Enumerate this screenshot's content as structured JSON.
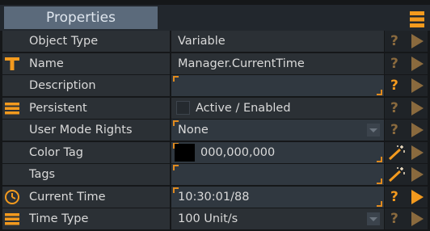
{
  "panel": {
    "title": "Properties",
    "accent_color": "#f39a1e",
    "menu_icon": "hamburger-menu-icon"
  },
  "rows": [
    {
      "key": "object_type",
      "label": "Object Type",
      "value": "Variable",
      "icon": null,
      "help_icon": "question-icon",
      "help_state": "dim",
      "play_state": "dim"
    },
    {
      "key": "name",
      "label": "Name",
      "value": "Manager.CurrentTime",
      "icon": "text-type-icon",
      "help_icon": "question-icon",
      "help_state": "dim",
      "play_state": "dim"
    },
    {
      "key": "description",
      "label": "Description",
      "value": "",
      "icon": null,
      "editable": true,
      "help_icon": "question-icon",
      "help_state": "bright",
      "play_state": "dim"
    },
    {
      "key": "persistent",
      "label": "Persistent",
      "value": "Active / Enabled",
      "icon": "list-icon",
      "checked": false,
      "help_icon": "question-icon",
      "help_state": "dim",
      "play_state": "dim"
    },
    {
      "key": "user_mode_rights",
      "label": "User Mode Rights",
      "value": "None",
      "icon": null,
      "editable": true,
      "dropdown": true,
      "help_icon": "question-icon",
      "help_state": "dim",
      "play_state": "dim"
    },
    {
      "key": "color_tag",
      "label": "Color Tag",
      "value": "000,000,000",
      "icon": null,
      "editable": true,
      "swatch_color": "#000000",
      "help_icon": "magic-wand-icon",
      "help_state": "bright",
      "play_state": "dim"
    },
    {
      "key": "tags",
      "label": "Tags",
      "value": "",
      "icon": null,
      "editable": true,
      "help_icon": "magic-wand-icon",
      "help_state": "bright",
      "play_state": "dim"
    },
    {
      "key": "current_time",
      "label": "Current Time",
      "value": "10:30:01/88",
      "icon": "clock-icon",
      "editable": true,
      "help_icon": "question-icon",
      "help_state": "bright",
      "play_state": "bright"
    },
    {
      "key": "time_type",
      "label": "Time Type",
      "value": "100 Unit/s",
      "icon": "list-icon",
      "dropdown": true,
      "help_icon": "question-icon",
      "help_state": "dim",
      "play_state": "dim"
    }
  ]
}
